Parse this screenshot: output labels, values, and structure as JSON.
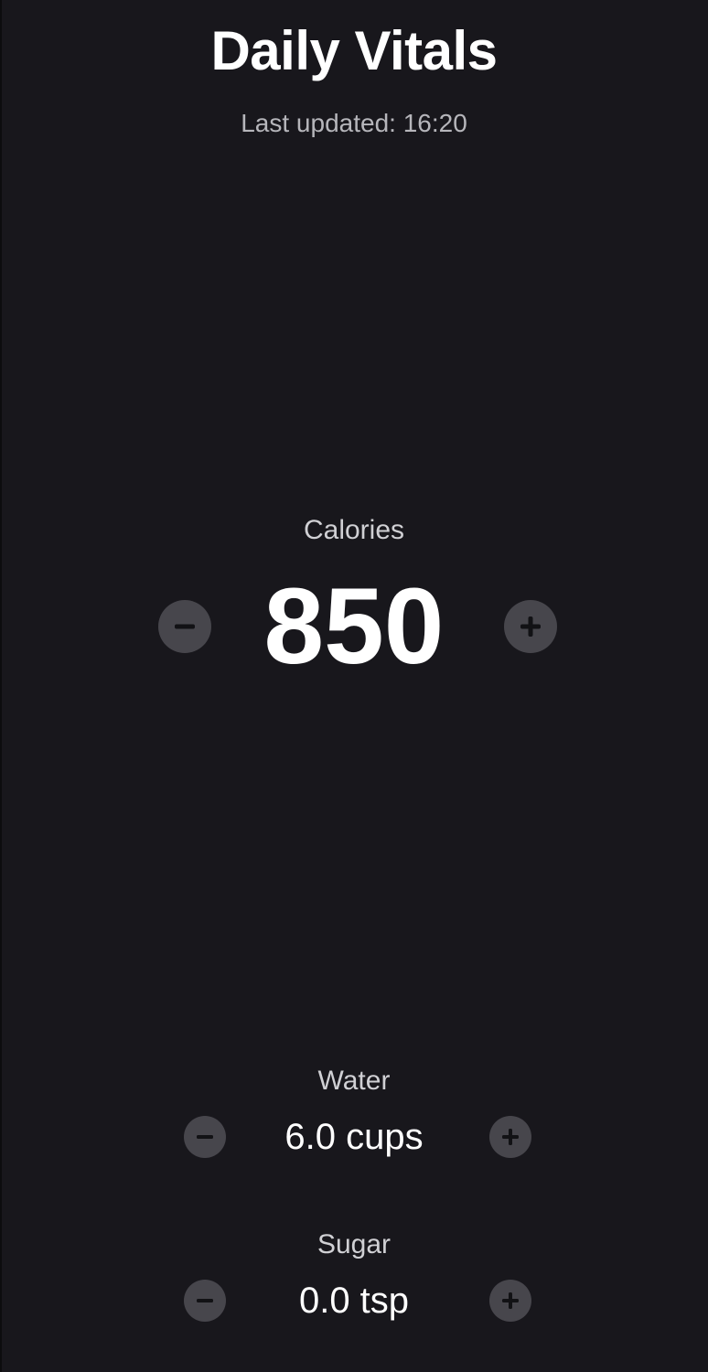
{
  "header": {
    "title": "Daily Vitals",
    "last_updated": "Last updated: 16:20"
  },
  "metrics": {
    "calories": {
      "label": "Calories",
      "value": "850"
    },
    "water": {
      "label": "Water",
      "value": "6.0 cups"
    },
    "sugar": {
      "label": "Sugar",
      "value": "0.0 tsp"
    }
  },
  "icons": {
    "decrement": "minus-icon",
    "increment": "plus-icon"
  },
  "colors": {
    "background": "#18171c",
    "button": "#47464c",
    "icon": "#121215",
    "text": "#ffffff",
    "muted_text": "#b6b6bb"
  }
}
